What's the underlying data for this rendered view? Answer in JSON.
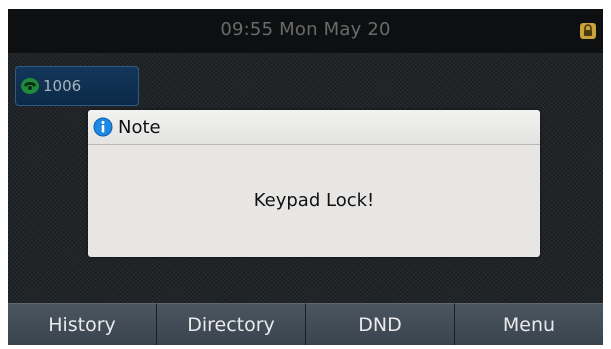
{
  "status_bar": {
    "datetime": "09:55 Mon May 20",
    "icons": [
      "lock-icon"
    ]
  },
  "line_key": {
    "label": "1006",
    "icon": "phone-handset-icon",
    "icon_color": "#2fae4a"
  },
  "dialog": {
    "icon": "info-icon",
    "title": "Note",
    "message": "Keypad Lock!"
  },
  "softkeys": [
    {
      "label": "History"
    },
    {
      "label": "Directory"
    },
    {
      "label": "DND"
    },
    {
      "label": "Menu"
    }
  ],
  "colors": {
    "screen_bg": "#1c1f22",
    "info_blue": "#1e88e5",
    "lock_gold": "#d4a93a"
  }
}
